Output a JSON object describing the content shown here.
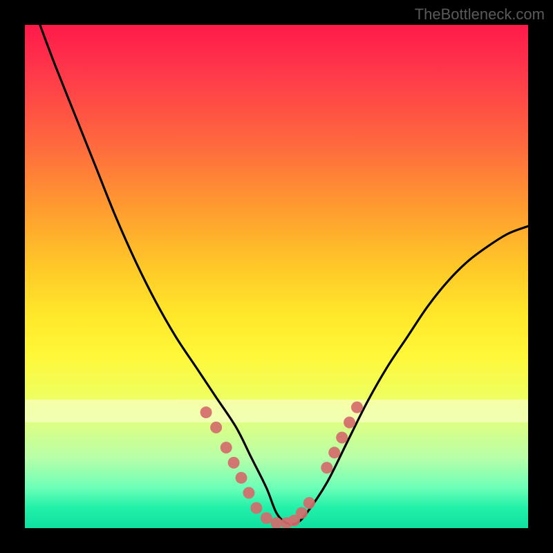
{
  "watermark": "TheBottleneck.com",
  "chart_data": {
    "type": "line",
    "title": "",
    "xlabel": "",
    "ylabel": "",
    "xlim": [
      0,
      100
    ],
    "ylim": [
      0,
      100
    ],
    "grid": false,
    "series": [
      {
        "name": "bottleneck-curve",
        "x": [
          3,
          6,
          10,
          14,
          18,
          22,
          26,
          30,
          34,
          38,
          42,
          45,
          48,
          50,
          52,
          54,
          56,
          60,
          64,
          68,
          72,
          76,
          80,
          84,
          88,
          92,
          96,
          100
        ],
        "y": [
          100,
          92,
          82,
          72,
          62,
          53,
          45,
          38,
          32,
          26,
          20,
          14,
          8,
          3,
          1,
          1,
          3,
          9,
          17,
          25,
          32,
          38,
          44,
          49,
          53,
          56,
          58.5,
          60
        ]
      }
    ],
    "markers": {
      "name": "highlight-dots",
      "color": "#d46b6b",
      "points": [
        {
          "x": 36,
          "y": 23
        },
        {
          "x": 38,
          "y": 20
        },
        {
          "x": 40,
          "y": 16
        },
        {
          "x": 41.5,
          "y": 13
        },
        {
          "x": 43,
          "y": 10
        },
        {
          "x": 44.5,
          "y": 7
        },
        {
          "x": 46,
          "y": 4
        },
        {
          "x": 48,
          "y": 2
        },
        {
          "x": 50,
          "y": 1
        },
        {
          "x": 52,
          "y": 1
        },
        {
          "x": 53.5,
          "y": 1.5
        },
        {
          "x": 55,
          "y": 3
        },
        {
          "x": 56.5,
          "y": 5
        },
        {
          "x": 60,
          "y": 12
        },
        {
          "x": 61.5,
          "y": 15
        },
        {
          "x": 63,
          "y": 18
        },
        {
          "x": 64.5,
          "y": 21
        },
        {
          "x": 66,
          "y": 24
        }
      ]
    }
  }
}
